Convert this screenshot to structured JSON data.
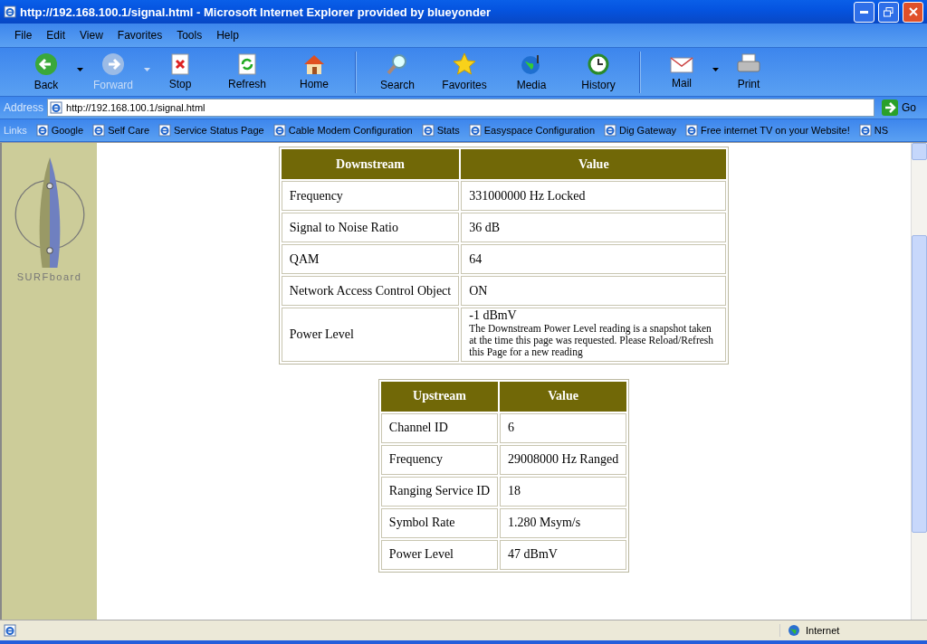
{
  "window": {
    "title": "http://192.168.100.1/signal.html - Microsoft Internet Explorer provided by blueyonder"
  },
  "menu": [
    "File",
    "Edit",
    "View",
    "Favorites",
    "Tools",
    "Help"
  ],
  "toolbar": [
    {
      "kind": "back",
      "label": "Back",
      "disabled": false,
      "dropdown": true
    },
    {
      "kind": "forward",
      "label": "Forward",
      "disabled": true,
      "dropdown": true
    },
    {
      "kind": "stop",
      "label": "Stop",
      "disabled": false,
      "dropdown": false
    },
    {
      "kind": "refresh",
      "label": "Refresh",
      "disabled": false,
      "dropdown": false
    },
    {
      "kind": "home",
      "label": "Home",
      "disabled": false,
      "dropdown": false
    },
    {
      "kind": "search",
      "label": "Search",
      "disabled": false,
      "dropdown": false
    },
    {
      "kind": "favorites",
      "label": "Favorites",
      "disabled": false,
      "dropdown": false
    },
    {
      "kind": "media",
      "label": "Media",
      "disabled": false,
      "dropdown": false
    },
    {
      "kind": "history",
      "label": "History",
      "disabled": false,
      "dropdown": false
    },
    {
      "kind": "mail",
      "label": "Mail",
      "disabled": false,
      "dropdown": true
    },
    {
      "kind": "print",
      "label": "Print",
      "disabled": false,
      "dropdown": false
    }
  ],
  "address": {
    "label": "Address",
    "value": "http://192.168.100.1/signal.html",
    "go": "Go"
  },
  "links": {
    "label": "Links",
    "items": [
      "Google",
      "Self Care",
      "Service Status Page",
      "Cable Modem Configuration",
      "Stats",
      "Easyspace Configuration",
      "Dig Gateway",
      "Free internet TV on your Website!",
      "NS"
    ]
  },
  "sidebar": {
    "logo_text": "SURFboard"
  },
  "downstream": {
    "columns": [
      "Downstream",
      "Value"
    ],
    "rows": [
      {
        "label": "Frequency",
        "value": "331000000 Hz Locked"
      },
      {
        "label": "Signal to Noise Ratio",
        "value": "36 dB"
      },
      {
        "label": "QAM",
        "value": "64"
      },
      {
        "label": "Network Access Control Object",
        "value": "ON"
      },
      {
        "label": "Power Level",
        "value": "-1 dBmV",
        "note": "The Downstream Power Level reading is a snapshot taken at the time this page was requested. Please Reload/Refresh this Page for a new reading"
      }
    ]
  },
  "upstream": {
    "columns": [
      "Upstream",
      "Value"
    ],
    "rows": [
      {
        "label": "Channel ID",
        "value": "6"
      },
      {
        "label": "Frequency",
        "value": "29008000 Hz Ranged"
      },
      {
        "label": "Ranging Service ID",
        "value": "18"
      },
      {
        "label": "Symbol Rate",
        "value": "1.280 Msym/s"
      },
      {
        "label": "Power Level",
        "value": "47 dBmV"
      }
    ]
  },
  "status_bar": {
    "zone": "Internet"
  }
}
